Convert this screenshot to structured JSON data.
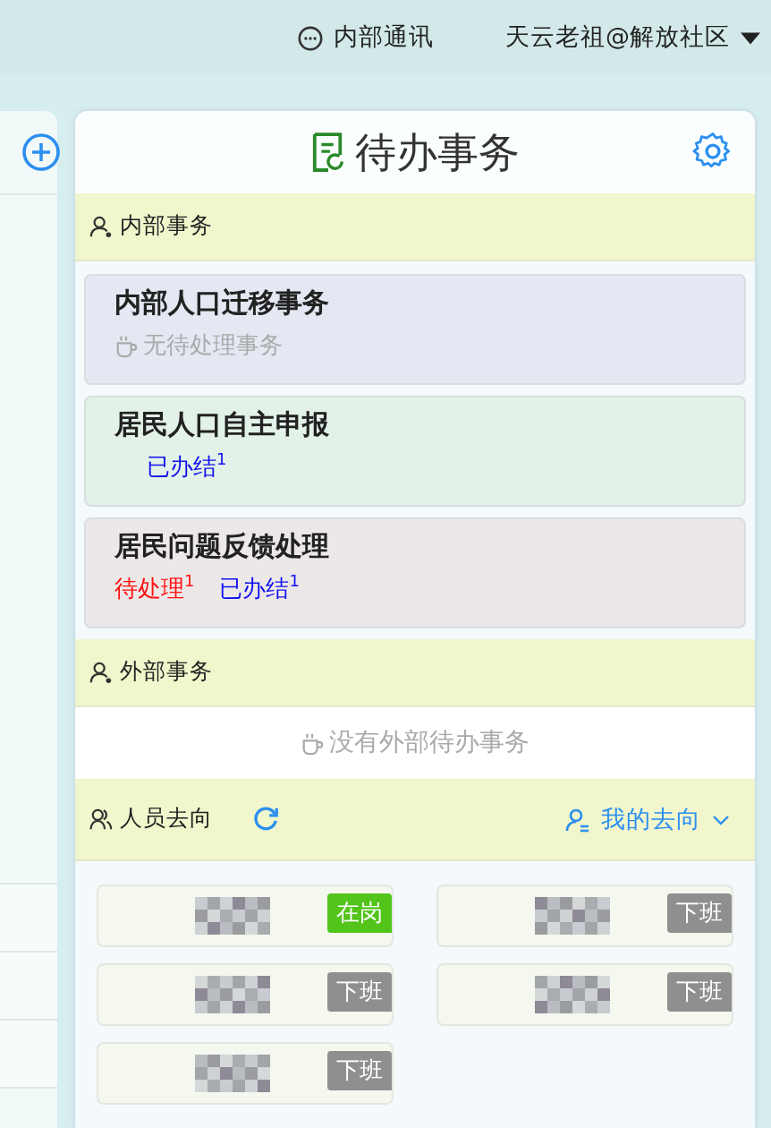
{
  "top_bar": {
    "messages_label": "内部通讯",
    "user_label": "天云老祖@解放社区"
  },
  "todo_panel": {
    "title": "待办事务",
    "internal": {
      "heading": "内部事务",
      "tasks": [
        {
          "title": "内部人口迁移事务",
          "color": "#e3e8f2",
          "empty_text": "无待处理事务"
        },
        {
          "title": "居民人口自主申报",
          "color": "#e2f2e8",
          "statuses": [
            {
              "kind": "done",
              "label": "已办结",
              "count": "1"
            }
          ]
        },
        {
          "title": "居民问题反馈处理",
          "color": "#ede8e8",
          "statuses": [
            {
              "kind": "pending",
              "label": "待处理",
              "count": "1"
            },
            {
              "kind": "done",
              "label": "已办结",
              "count": "1"
            }
          ]
        }
      ]
    },
    "external": {
      "heading": "外部事务",
      "empty_text": "没有外部待办事务"
    },
    "personnel": {
      "heading": "人员去向",
      "my_status_label": "我的去向",
      "staff": [
        {
          "status": "在岗",
          "on_duty": true
        },
        {
          "status": "下班",
          "on_duty": false
        },
        {
          "status": "下班",
          "on_duty": false
        },
        {
          "status": "下班",
          "on_duty": false
        },
        {
          "status": "下班",
          "on_duty": false
        }
      ]
    }
  }
}
